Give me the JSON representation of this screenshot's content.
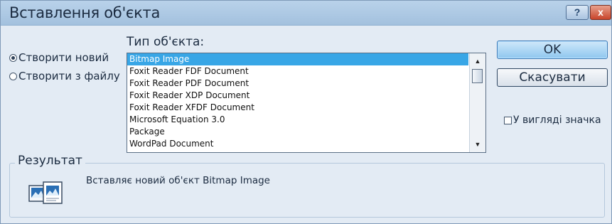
{
  "window": {
    "title": "Вставлення об'єкта",
    "help_label": "?",
    "close_label": "x"
  },
  "mode": {
    "options": [
      {
        "label": "Створити новий",
        "selected": true
      },
      {
        "label": "Створити з файлу",
        "selected": false
      }
    ]
  },
  "object_type": {
    "label": "Тип об'єкта:",
    "items": [
      "Bitmap Image",
      "Foxit Reader FDF Document",
      "Foxit Reader PDF Document",
      "Foxit Reader XDP Document",
      "Foxit Reader XFDF Document",
      "Microsoft Equation 3.0",
      "Package",
      "WordPad Document"
    ],
    "selected_index": 0
  },
  "buttons": {
    "ok_label": "OK",
    "cancel_label": "Скасувати"
  },
  "display_as_icon": {
    "label": "У вигляді значка",
    "checked": false
  },
  "result": {
    "label": "Результат",
    "text": "Вставляє новий об'єкт Bitmap Image",
    "icon": "bitmap-image-icon"
  },
  "colors": {
    "selection": "#38a6e6",
    "titlebar": "#a3c1de",
    "ok_button": "#8fc7ef"
  }
}
